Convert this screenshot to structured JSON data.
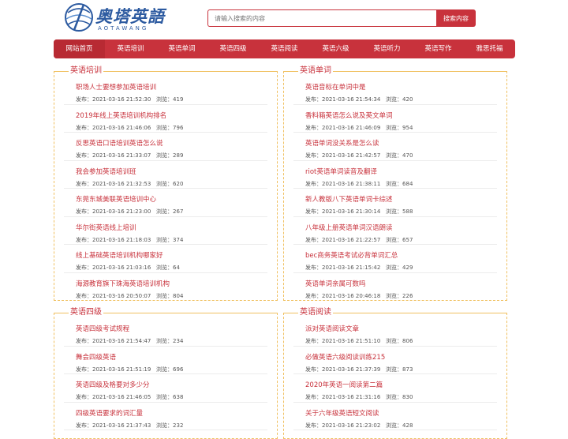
{
  "header": {
    "logo_text": "奥塔英語",
    "logo_sub": "AOTAWANG",
    "search_placeholder": "请输入搜索的内容",
    "search_button": "搜索内容"
  },
  "nav": [
    "网站首页",
    "英语培训",
    "英语单词",
    "英语四级",
    "英语阅读",
    "英语六级",
    "英语听力",
    "英语写作",
    "雅思托福"
  ],
  "colors": {
    "accent": "#c8323c",
    "border": "#f0c060",
    "logo": "#2c5aa0"
  },
  "labels": {
    "pub": "发布：",
    "views": "浏览："
  },
  "sections": [
    {
      "title": "英语培训",
      "items": [
        {
          "title": "职场人士要想参加英语培训",
          "date": "2021-03-16 21:52:30",
          "views": "419"
        },
        {
          "title": "2019年线上英语培训机构排名",
          "date": "2021-03-16 21:46:06",
          "views": "796"
        },
        {
          "title": "反思英语口语培训英语怎么说",
          "date": "2021-03-16 21:33:07",
          "views": "289"
        },
        {
          "title": "我会参加英语培训班",
          "date": "2021-03-16 21:32:53",
          "views": "620"
        },
        {
          "title": "东莞东城美联英语培训中心",
          "date": "2021-03-16 21:23:00",
          "views": "267"
        },
        {
          "title": "华尔街英语线上培训",
          "date": "2021-03-16 21:18:03",
          "views": "374"
        },
        {
          "title": "线上基础英语培训机构哪家好",
          "date": "2021-03-16 21:03:16",
          "views": "64"
        },
        {
          "title": "海源教育旗下珠海英语培训机构",
          "date": "2021-03-16 20:50:07",
          "views": "804"
        }
      ]
    },
    {
      "title": "英语单词",
      "items": [
        {
          "title": "英语音标在单词中是",
          "date": "2021-03-16 21:54:34",
          "views": "420"
        },
        {
          "title": "香料箱英语怎么说及英文单词",
          "date": "2021-03-16 21:46:09",
          "views": "954"
        },
        {
          "title": "英语单词没关系是怎么读",
          "date": "2021-03-16 21:42:57",
          "views": "470"
        },
        {
          "title": "riot英语单词读音及翻译",
          "date": "2021-03-16 21:38:11",
          "views": "684"
        },
        {
          "title": "新人教版八下英语单词卡综述",
          "date": "2021-03-16 21:30:14",
          "views": "588"
        },
        {
          "title": "八年级上册英语单词汉语朗读",
          "date": "2021-03-16 21:22:57",
          "views": "657"
        },
        {
          "title": "bec商务英语考试必背单词汇总",
          "date": "2021-03-16 21:15:42",
          "views": "429"
        },
        {
          "title": "英语单词亲属可数吗",
          "date": "2021-03-16 20:46:18",
          "views": "226"
        }
      ]
    },
    {
      "title": "英语四级",
      "items": [
        {
          "title": "英语四级考试规程",
          "date": "2021-03-16 21:54:47",
          "views": "234"
        },
        {
          "title": "舞会四级英语",
          "date": "2021-03-16 21:51:19",
          "views": "696"
        },
        {
          "title": "英语四级及格要对多少分",
          "date": "2021-03-16 21:46:05",
          "views": "638"
        },
        {
          "title": "四级英语要求的词汇量",
          "date": "2021-03-16 21:37:43",
          "views": "232"
        }
      ]
    },
    {
      "title": "英语阅读",
      "items": [
        {
          "title": "派对英语阅读文章",
          "date": "2021-03-16 21:51:10",
          "views": "806"
        },
        {
          "title": "必做英语六级阅读训练215",
          "date": "2021-03-16 21:37:39",
          "views": "873"
        },
        {
          "title": "2020年英语一阅读第二篇",
          "date": "2021-03-16 21:31:16",
          "views": "830"
        },
        {
          "title": "关于六年级英语短文阅读",
          "date": "2021-03-16 21:23:02",
          "views": "428"
        }
      ]
    }
  ]
}
